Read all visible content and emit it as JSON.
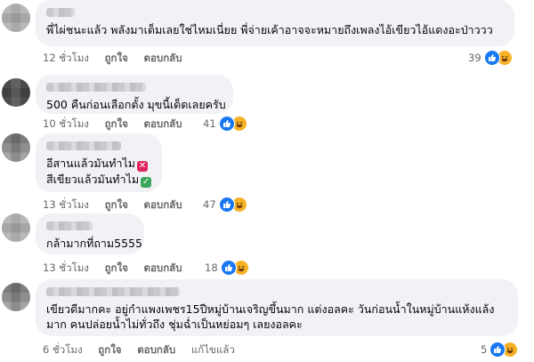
{
  "comments": [
    {
      "text_lines": [
        "พี่ไผ่ชนะแล้ว พลังมาเต็มเลยใช่ไหมเนี่ยย พี่จ่ายเค้าอาจจะหมายถึงเพลงไอ้เขียวไอ้แดงอะป่าววว"
      ],
      "time": "12 ชั่วโมง",
      "like_label": "ถูกใจ",
      "reply_label": "ตอบกลับ",
      "reaction_count": "39",
      "reaction_icons": [
        "like-icon",
        "haha-icon"
      ]
    },
    {
      "text_lines": [
        "500 คืนก่อนเลือกตั้ง มุขนี้เด็ดเลยครับ"
      ],
      "time": "10 ชั่วโมง",
      "like_label": "ถูกใจ",
      "reply_label": "ตอบกลับ",
      "reaction_count": "41",
      "reaction_icons": [
        "like-icon",
        "haha-icon"
      ]
    },
    {
      "text_lines": [
        "อีสานแล้วมันทำไม",
        "สีเขียวแล้วมันทำไม"
      ],
      "line_emojis": [
        "cross-mark-emoji",
        "check-mark-emoji"
      ],
      "time": "13 ชั่วโมง",
      "like_label": "ถูกใจ",
      "reply_label": "ตอบกลับ",
      "reaction_count": "47",
      "reaction_icons": [
        "like-icon",
        "haha-icon"
      ]
    },
    {
      "text_lines": [
        "กล้ามากที่ถาม5555"
      ],
      "time": "13 ชั่วโมง",
      "like_label": "ถูกใจ",
      "reply_label": "ตอบกลับ",
      "reaction_count": "18",
      "reaction_icons": [
        "like-icon",
        "haha-icon"
      ]
    },
    {
      "text_lines": [
        "เขียวดีมากคะ อยู่กำแพงเพชร15ปีหมู่บ้านเจริญขึ้นมาก แต่งอลคะ วันก่อนน้ำในหมู่บ้านแห้งแล้ง",
        "มาก คนปล่อยน้ำไม่ทั่วถึง ชุ่มฉ่ำเป็นหย่อมๆ เลยงอลคะ"
      ],
      "time": "6 ชั่วโมง",
      "like_label": "ถูกใจ",
      "reply_label": "ตอบกลับ",
      "edited_label": "แก้ไขแล้ว",
      "reaction_count": "5",
      "reaction_icons": [
        "like-icon",
        "haha-icon"
      ]
    }
  ],
  "colors": {
    "bubble": "#f0f2f5",
    "meta_text": "#65676b",
    "like_blue": "#1877f2",
    "haha_yellow": "#f7b125"
  }
}
